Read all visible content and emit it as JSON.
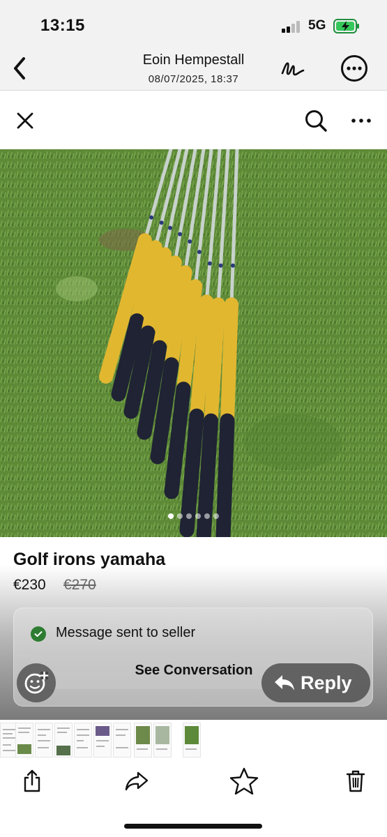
{
  "status_bar": {
    "time": "13:15",
    "network": "5G"
  },
  "email": {
    "sender": "Eoin Hempestall",
    "date": "08/07/2025, 18:37"
  },
  "listing": {
    "title": "Golf irons yamaha",
    "price": "€230",
    "original_price": "€270",
    "image_count": 6,
    "current_image": 1
  },
  "message": {
    "status_text": "Message sent to seller",
    "see_conversation_label": "See Conversation"
  },
  "reply": {
    "label": "Reply"
  },
  "colors": {
    "check_green": "#2e7d32",
    "grass": "#5f8a3a",
    "grip_yellow": "#e2b730",
    "grip_black": "#1f2333"
  },
  "icons": {
    "back": "chevron-left-icon",
    "markup": "markup-pen-icon",
    "more_top": "ellipsis-circle-icon",
    "close": "close-icon",
    "search": "search-icon",
    "more": "ellipsis-icon",
    "emoji": "add-reaction-icon",
    "reply": "reply-arrow-icon",
    "share": "share-icon",
    "forward": "forward-icon",
    "favorite": "star-icon",
    "delete": "trash-icon"
  }
}
